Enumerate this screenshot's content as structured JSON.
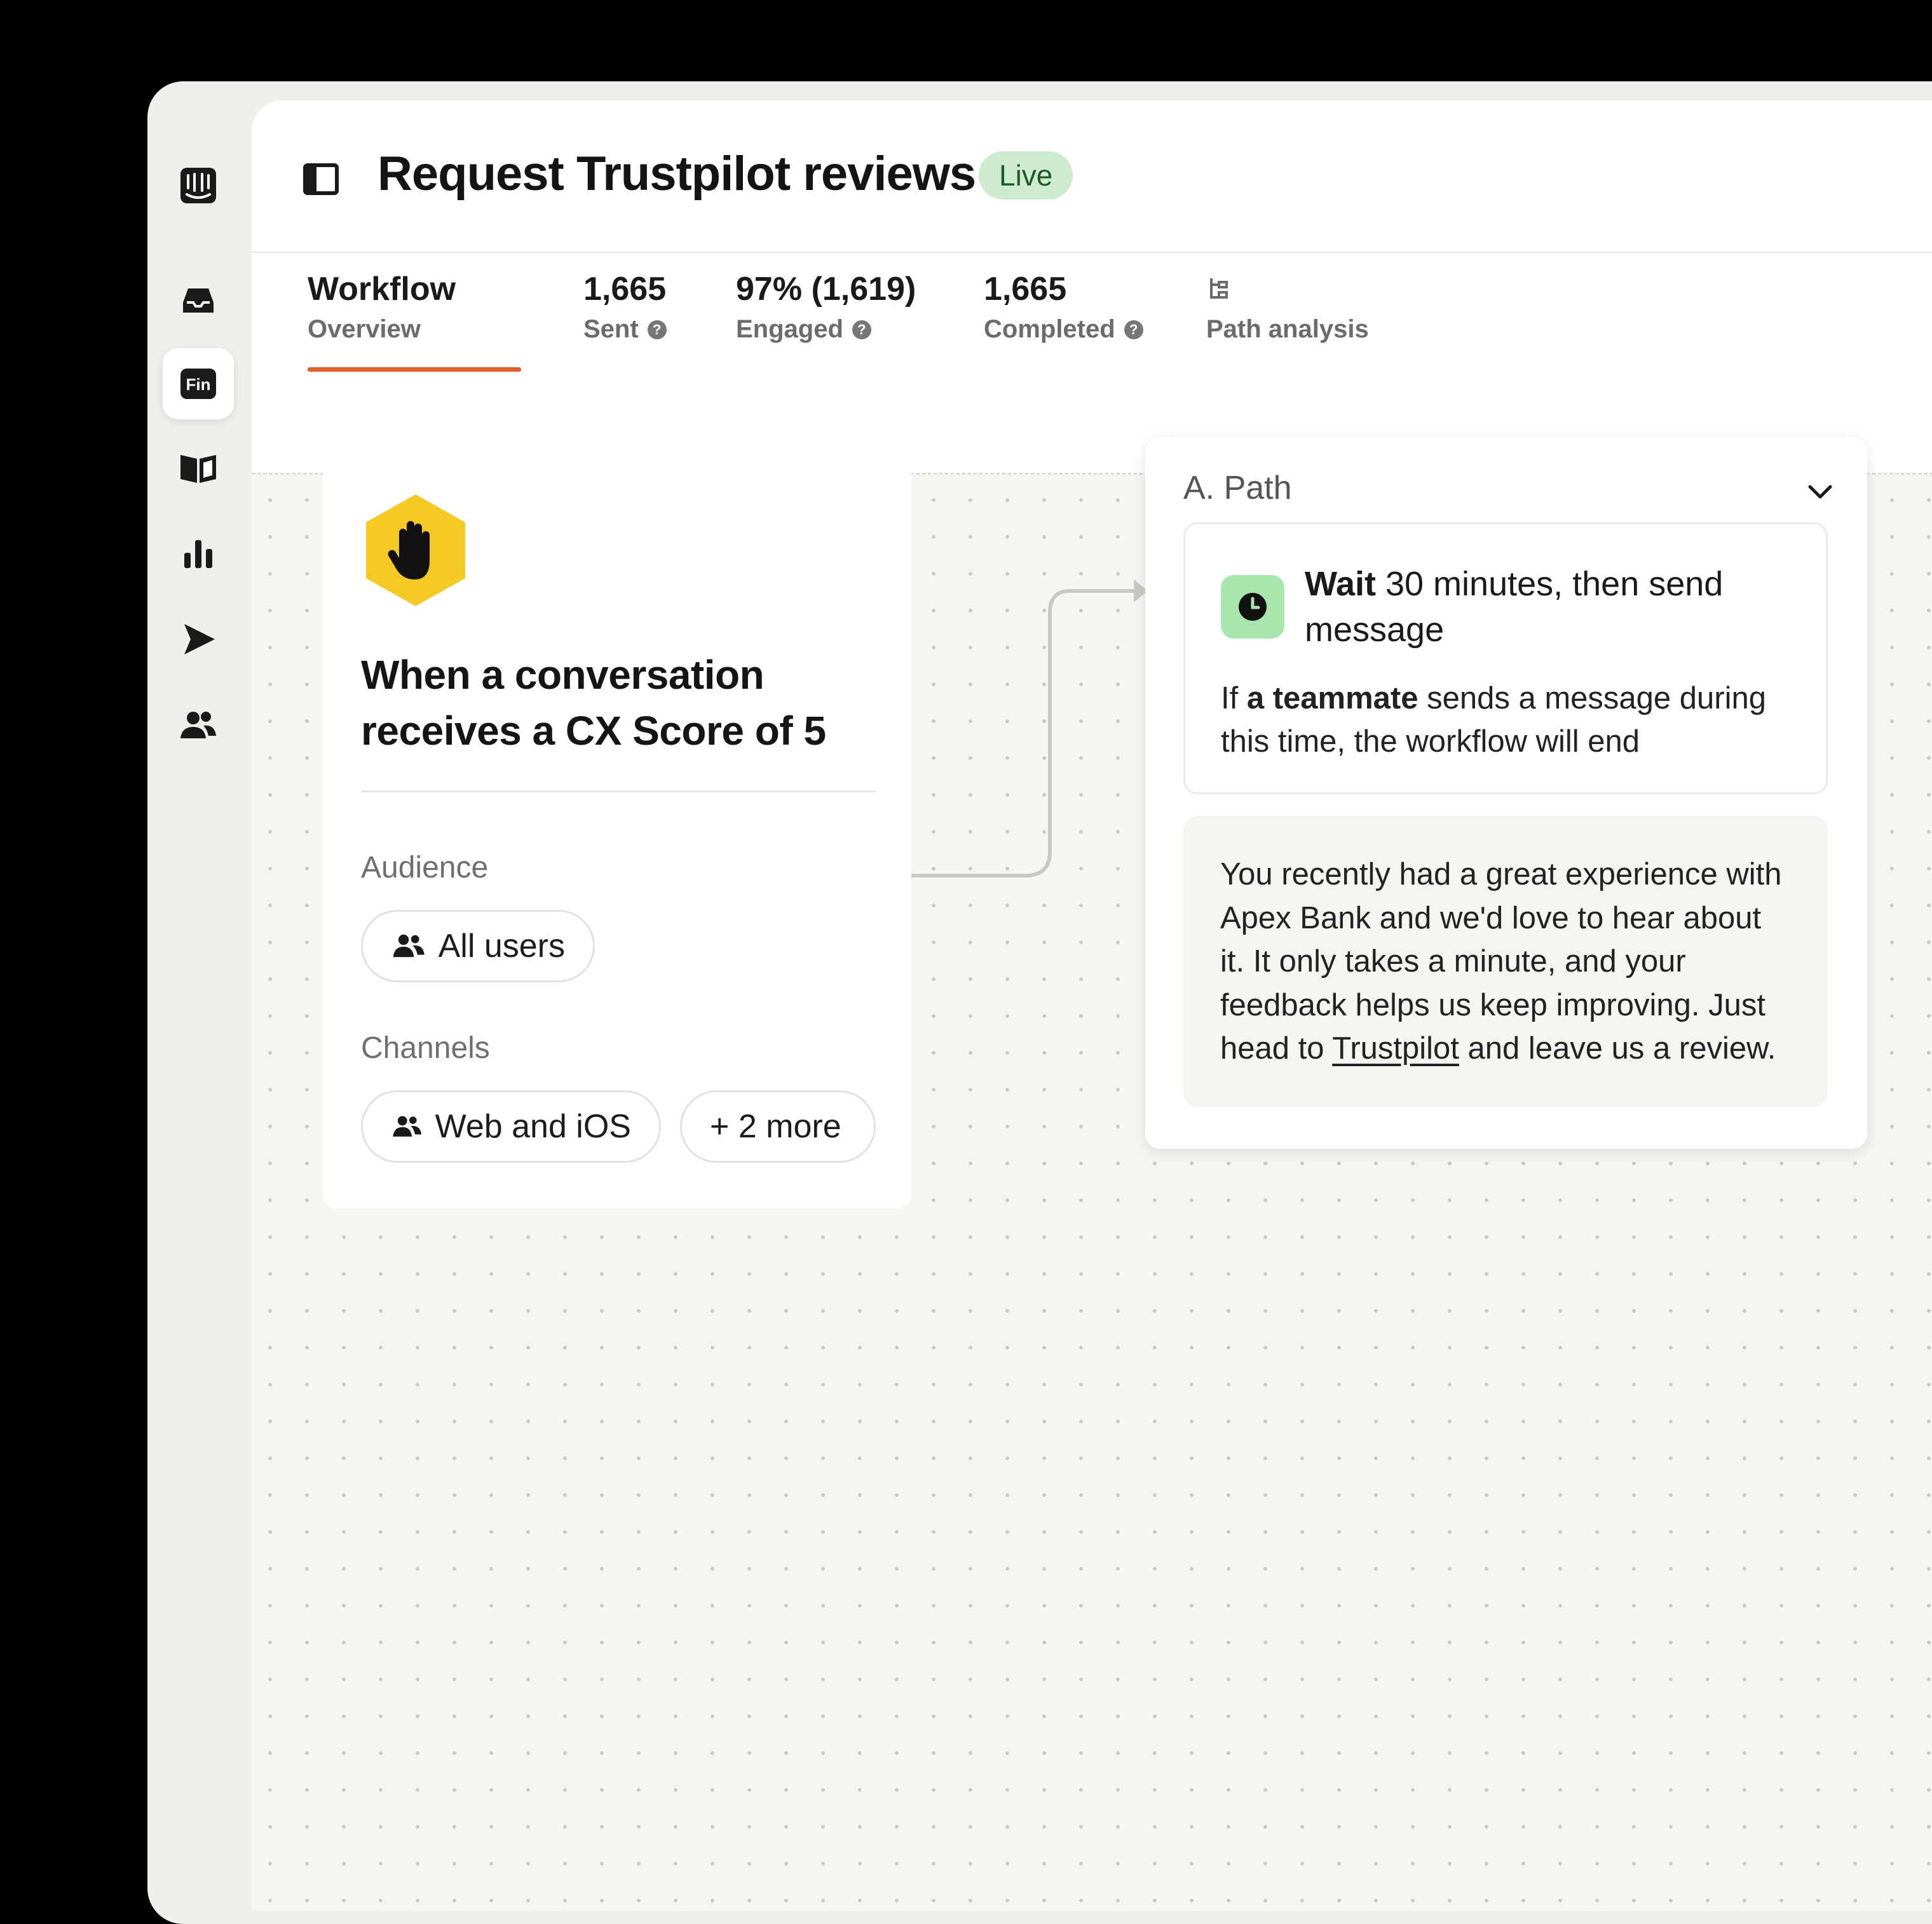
{
  "header": {
    "title": "Request Trustpilot reviews",
    "status": "Live"
  },
  "sidebar": {
    "items": [
      {
        "icon": "logo-icon"
      },
      {
        "icon": "inbox-icon"
      },
      {
        "icon": "fin-icon",
        "label": "Fin",
        "active": true
      },
      {
        "icon": "book-icon"
      },
      {
        "icon": "reports-icon"
      },
      {
        "icon": "outbound-icon"
      },
      {
        "icon": "contacts-icon"
      }
    ]
  },
  "tabs": [
    {
      "value": "Workflow",
      "label": "Overview",
      "active": true
    },
    {
      "value": "1,665",
      "label": "Sent",
      "help": true
    },
    {
      "value": "97% (1,619)",
      "label": "Engaged",
      "help": true
    },
    {
      "value": "1,665",
      "label": "Completed",
      "help": true
    },
    {
      "icon": "path-analysis-icon",
      "label": "Path analysis"
    }
  ],
  "trigger": {
    "title": "When a conversation receives a CX Score of 5",
    "audience_label": "Audience",
    "audience_value": "All users",
    "channels_label": "Channels",
    "channels_value": "Web and iOS",
    "channels_more": "+ 2 more"
  },
  "path": {
    "title": "A. Path",
    "wait_bold": "Wait",
    "wait_rest": " 30 minutes, then send message",
    "note_prefix": "If ",
    "note_bold": "a teammate",
    "note_rest": " sends a message during this time, the workflow will end",
    "message_before": "You recently had a great experience with Apex Bank and we'd love to hear about it. It only takes a minute, and your feedback helps us keep improving. Just head to ",
    "message_link": "Trustpilot",
    "message_after": " and leave us a review."
  },
  "colors": {
    "accent_underline": "#e0622a",
    "live_badge_bg": "#cdeccf",
    "hexagon": "#f5c924",
    "clock_badge": "#a8e6ad"
  }
}
